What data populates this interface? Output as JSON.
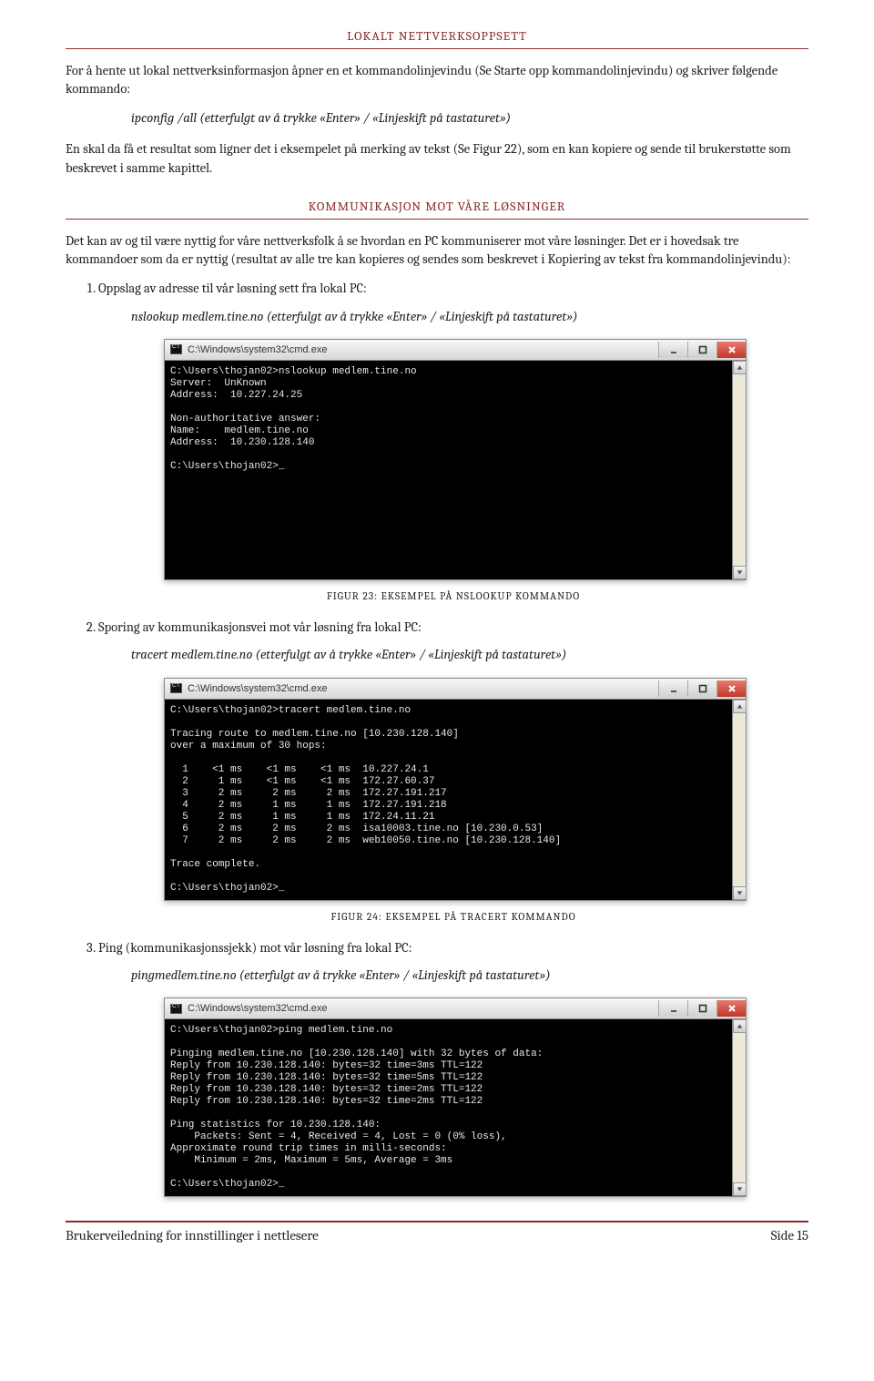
{
  "heading_main": "LOKALT NETTVERKSOPPSETT",
  "para1": "For å hente ut lokal nettverksinformasjon åpner en et kommandolinjevindu (Se Starte opp kommandolinjevindu) og skriver følgende kommando:",
  "cmd1": "ipconfig /all (etterfulgt av å trykke «Enter» / «Linjeskift på tastaturet»)",
  "para2": "En skal da få et resultat som ligner det i eksempelet på merking av tekst (Se Figur 22), som en kan kopiere og sende til brukerstøtte som beskrevet i samme kapittel.",
  "heading_sub": "KOMMUNIKASJON MOT VÅRE LØSNINGER",
  "para3": "Det kan av og til være nyttig for våre nettverksfolk å se hvordan en PC kommuniserer mot våre løsninger. Det er i hovedsak tre kommandoer som da er nyttig (resultat av alle tre kan kopieres og sendes som beskrevet i Kopiering av tekst fra kommandolinjevindu):",
  "li1": "Oppslag av adresse til vår løsning sett fra lokal PC:",
  "li1_cmd": "nslookup medlem.tine.no (etterfulgt av å trykke «Enter» / «Linjeskift på tastaturet»)",
  "term_title": "C:\\Windows\\system32\\cmd.exe",
  "term1_body": "C:\\Users\\thojan02>nslookup medlem.tine.no\nServer:  UnKnown\nAddress:  10.227.24.25\n\nNon-authoritative answer:\nName:    medlem.tine.no\nAddress:  10.230.128.140\n\nC:\\Users\\thojan02>_",
  "fig23": "FIGUR 23: EKSEMPEL PÅ NSLOOKUP KOMMANDO",
  "li2": "Sporing av kommunikasjonsvei mot vår løsning fra lokal PC:",
  "li2_cmd": "tracert medlem.tine.no (etterfulgt av å trykke «Enter» / «Linjeskift på tastaturet»)",
  "term2_body": "C:\\Users\\thojan02>tracert medlem.tine.no\n\nTracing route to medlem.tine.no [10.230.128.140]\nover a maximum of 30 hops:\n\n  1    <1 ms    <1 ms    <1 ms  10.227.24.1\n  2     1 ms    <1 ms    <1 ms  172.27.60.37\n  3     2 ms     2 ms     2 ms  172.27.191.217\n  4     2 ms     1 ms     1 ms  172.27.191.218\n  5     2 ms     1 ms     1 ms  172.24.11.21\n  6     2 ms     2 ms     2 ms  isa10003.tine.no [10.230.0.53]\n  7     2 ms     2 ms     2 ms  web10050.tine.no [10.230.128.140]\n\nTrace complete.\n\nC:\\Users\\thojan02>_",
  "fig24": "FIGUR 24: EKSEMPEL PÅ TRACERT KOMMANDO",
  "li3": "Ping (kommunikasjonssjekk) mot vår løsning fra lokal PC:",
  "li3_cmd": "pingmedlem.tine.no (etterfulgt av å trykke «Enter» / «Linjeskift på tastaturet»)",
  "term3_body": "C:\\Users\\thojan02>ping medlem.tine.no\n\nPinging medlem.tine.no [10.230.128.140] with 32 bytes of data:\nReply from 10.230.128.140: bytes=32 time=3ms TTL=122\nReply from 10.230.128.140: bytes=32 time=5ms TTL=122\nReply from 10.230.128.140: bytes=32 time=2ms TTL=122\nReply from 10.230.128.140: bytes=32 time=2ms TTL=122\n\nPing statistics for 10.230.128.140:\n    Packets: Sent = 4, Received = 4, Lost = 0 (0% loss),\nApproximate round trip times in milli-seconds:\n    Minimum = 2ms, Maximum = 5ms, Average = 3ms\n\nC:\\Users\\thojan02>_",
  "footer_left": "Brukerveiledning for innstillinger i nettlesere",
  "footer_right": "Side 15"
}
